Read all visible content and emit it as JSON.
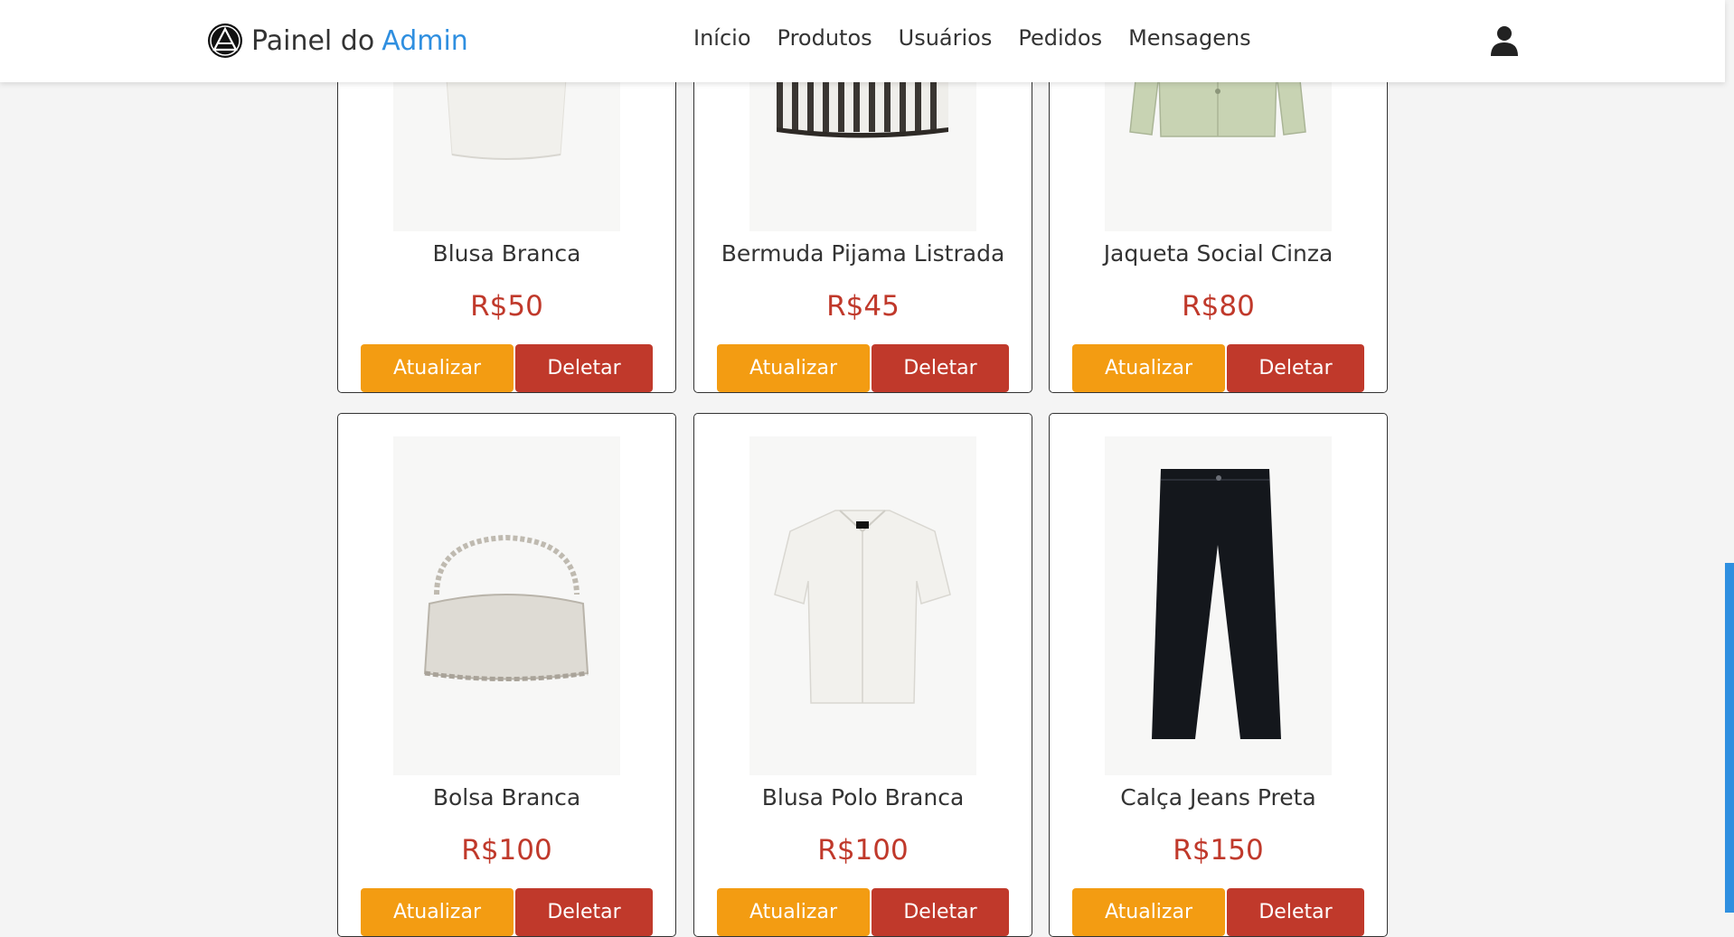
{
  "header": {
    "brand_prefix": "Painel do",
    "brand_accent": "Admin",
    "nav": [
      "Início",
      "Produtos",
      "Usuários",
      "Pedidos",
      "Mensagens"
    ],
    "user_icon": "user-icon"
  },
  "colors": {
    "accent": "#2f8fe0",
    "price": "#c0392b",
    "update_button": "#f39c12",
    "delete_button": "#c0392b"
  },
  "buttons": {
    "update": "Atualizar",
    "delete": "Deletar"
  },
  "products": [
    {
      "name": "Blusa Branca",
      "price": "R$50"
    },
    {
      "name": "Bermuda Pijama Listrada",
      "price": "R$45"
    },
    {
      "name": "Jaqueta Social Cinza",
      "price": "R$80"
    },
    {
      "name": "Bolsa Branca",
      "price": "R$100"
    },
    {
      "name": "Blusa Polo Branca",
      "price": "R$100"
    },
    {
      "name": "Calça Jeans Preta",
      "price": "R$150"
    }
  ]
}
